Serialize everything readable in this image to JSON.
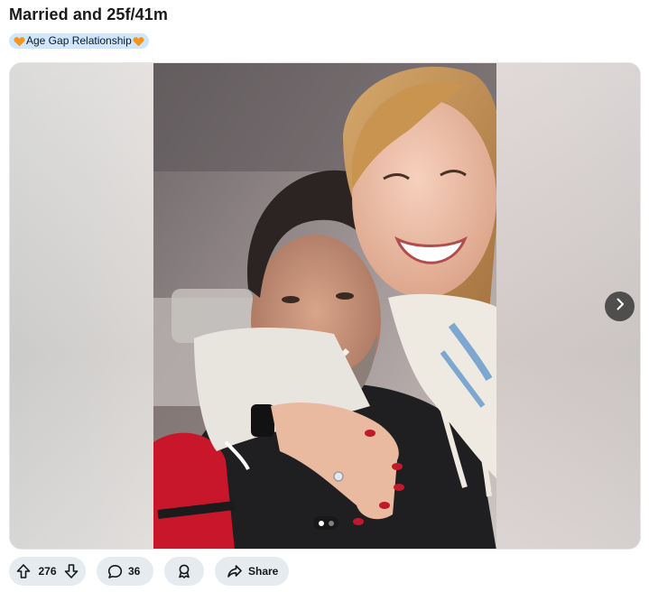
{
  "post": {
    "title": "Married and 25f/41m",
    "flair": {
      "text": "Age Gap Relationship",
      "emoji": "orange-heart",
      "bg_color": "#cfe6ff"
    }
  },
  "gallery": {
    "image_alt": "Selfie of a smiling couple, woman hugging man from behind showing engagement ring",
    "total_images": 2,
    "current_index": 1,
    "next_icon": "chevron-right-icon"
  },
  "actions": {
    "upvote_icon": "arrow-up-icon",
    "vote_count": "276",
    "downvote_icon": "arrow-down-icon",
    "comment_icon": "comment-bubble-icon",
    "comment_count": "36",
    "award_icon": "award-icon",
    "share_icon": "share-arrow-icon",
    "share_label": "Share",
    "pill_color": "#e5ebee"
  }
}
